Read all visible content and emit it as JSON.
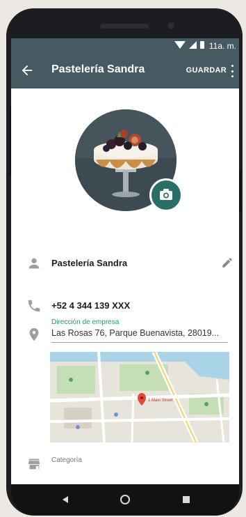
{
  "status": {
    "time": "11a. m."
  },
  "appbar": {
    "title": "Pastelería Sandra",
    "save_label": "GUARDAR"
  },
  "profile": {
    "name": "Pastelería Sandra",
    "phone": "+52 4 344 139 XXX"
  },
  "address": {
    "label": "Dirección de empresa",
    "value": "Las Rosas 76, Parque Buenavista, 28019..."
  },
  "map": {
    "pin_label": "1 Main Street"
  },
  "category": {
    "label": "Categoría"
  },
  "colors": {
    "appbar": "#465a62",
    "accent": "#1f9a74",
    "fab": "#2a6f63"
  },
  "icons": [
    "back-arrow-icon",
    "more-vert-icon",
    "camera-icon",
    "person-icon",
    "edit-icon",
    "phone-icon",
    "location-icon",
    "store-icon",
    "nav-back-icon",
    "nav-home-icon",
    "nav-recents-icon"
  ]
}
